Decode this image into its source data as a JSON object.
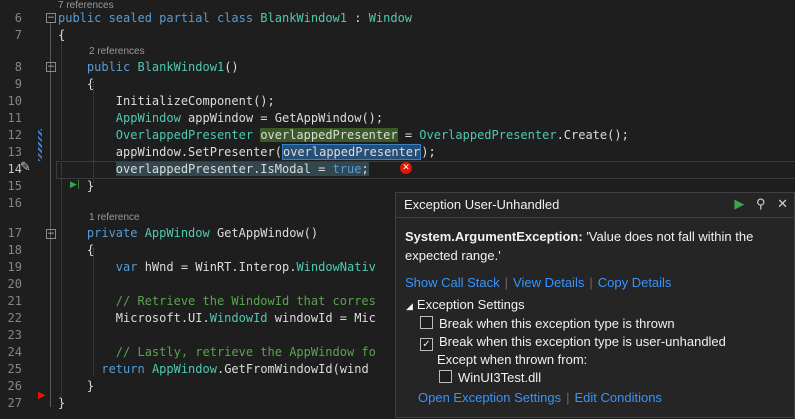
{
  "editor": {
    "lines": [
      {
        "n": "6",
        "text": "public sealed partial class BlankWindow1 : Window"
      },
      {
        "n": "7",
        "text": "{"
      },
      {
        "n": "8",
        "text": "    public BlankWindow1()"
      },
      {
        "n": "9",
        "text": "    {"
      },
      {
        "n": "10",
        "text": "        InitializeComponent();"
      },
      {
        "n": "11",
        "text": "        AppWindow appWindow = GetAppWindow();"
      },
      {
        "n": "12",
        "text": "        OverlappedPresenter overlappedPresenter = OverlappedPresenter.Create();"
      },
      {
        "n": "13",
        "text": "        appWindow.SetPresenter(overlappedPresenter);"
      },
      {
        "n": "14",
        "text": "        overlappedPresenter.IsModal = true;"
      },
      {
        "n": "15",
        "text": "    }"
      },
      {
        "n": "16",
        "text": ""
      },
      {
        "n": "17",
        "text": "    private AppWindow GetAppWindow()"
      },
      {
        "n": "18",
        "text": "    {"
      },
      {
        "n": "19",
        "text": "        var hWnd = WinRT.Interop.WindowNativ"
      },
      {
        "n": "20",
        "text": ""
      },
      {
        "n": "21",
        "text": "        // Retrieve the WindowId that corres"
      },
      {
        "n": "22",
        "text": "        Microsoft.UI.WindowId windowId = Mic"
      },
      {
        "n": "23",
        "text": ""
      },
      {
        "n": "24",
        "text": "        // Lastly, retrieve the AppWindow fo"
      },
      {
        "n": "25",
        "text": "        return AppWindow.GetFromWindowId(wind"
      },
      {
        "n": "26",
        "text": "    }"
      },
      {
        "n": "27",
        "text": "}"
      }
    ],
    "codelens": {
      "class_refs": "7 references",
      "ctor_refs": "2 references",
      "method_refs": "1 reference"
    }
  },
  "exception_popup": {
    "title": "Exception User-Unhandled",
    "exception_type": "System.ArgumentException:",
    "message": " 'Value does not fall within the expected range.'",
    "links": [
      "Show Call Stack",
      "View Details",
      "Copy Details"
    ],
    "settings_header": "Exception Settings",
    "break_thrown": "Break when this exception type is thrown",
    "break_thrown_checked": false,
    "break_unhandled": "Break when this exception type is user-unhandled",
    "break_unhandled_checked": true,
    "except_when": "Except when thrown from:",
    "module": "WinUI3Test.dll",
    "module_checked": false,
    "bottom_links": [
      "Open Exception Settings",
      "Edit Conditions"
    ],
    "icons": [
      "play-icon",
      "pin-icon",
      "close-icon"
    ]
  },
  "colors": {
    "background": "#1e1e1e",
    "keyword": "#569cd6",
    "type": "#4ec9b0",
    "comment": "#57a64a",
    "link": "#3794ff",
    "error": "#e51400"
  }
}
